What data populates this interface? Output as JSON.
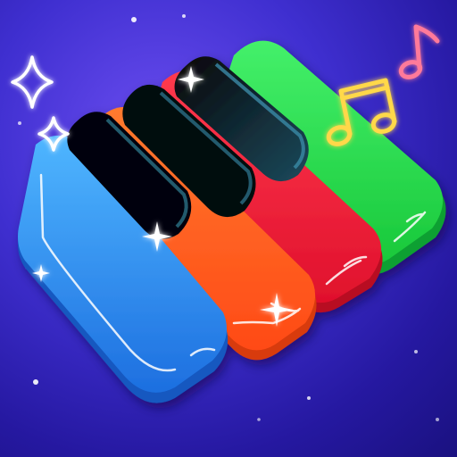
{
  "app": {
    "kind": "game-icon",
    "theme": "neon piano"
  },
  "colors": {
    "background_light": "#6a4df0",
    "background_dark": "#1a1180",
    "key_blue": "#2d8df0",
    "key_orange": "#ff5a1e",
    "key_red": "#f0203c",
    "key_green": "#22e04a",
    "black_key": "#0f2a3a",
    "note_yellow": "#ffd84a",
    "note_pink": "#ff7a9a",
    "sparkle_white": "#ffffff"
  },
  "icons": {
    "keyboard": "piano-keys-icon",
    "notes": "music-notes-icon",
    "sparkles": "sparkle-icon"
  }
}
